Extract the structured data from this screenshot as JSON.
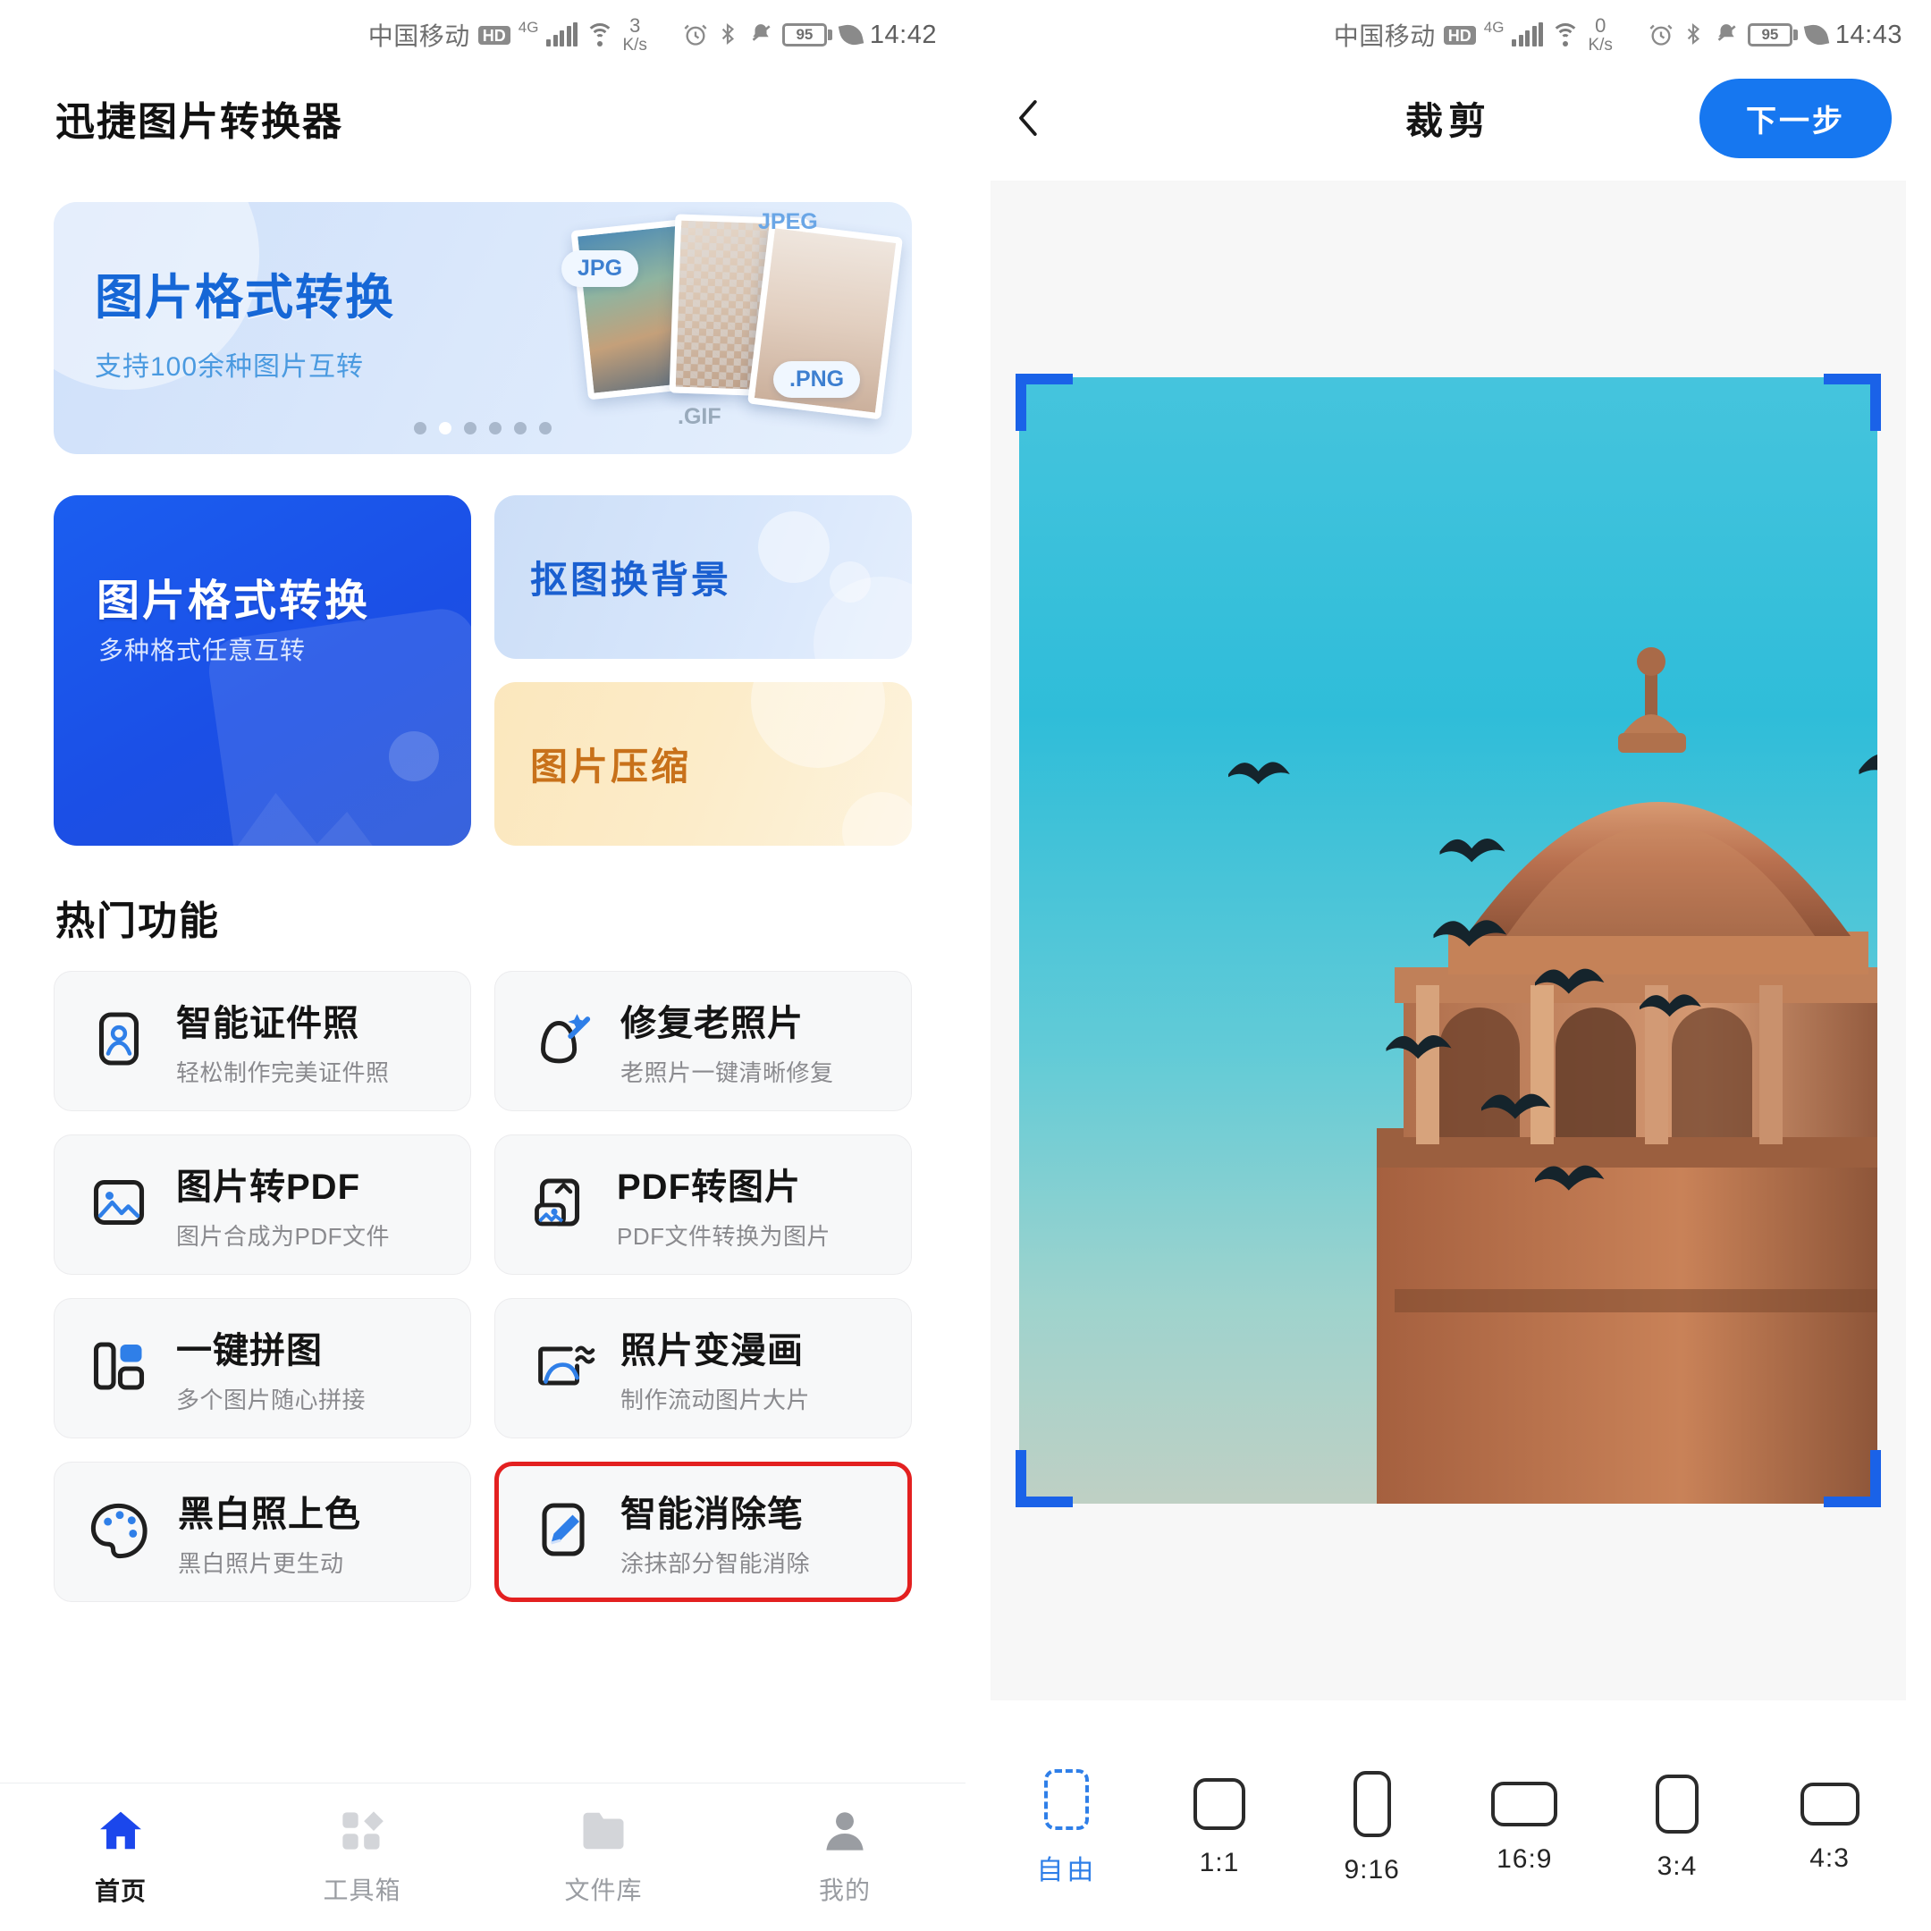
{
  "left": {
    "status": {
      "carrier": "中国移动",
      "hd": "HD",
      "net": "4G",
      "speed_value": "3",
      "speed_unit": "K/s",
      "battery": "95",
      "time": "14:42"
    },
    "app_title": "迅捷图片转换器",
    "banner": {
      "title": "图片格式转换",
      "subtitle": "支持100余种图片互转",
      "tags": {
        "jpg": "JPG",
        "jpeg": "JPEG",
        "png": ".PNG",
        "gif": ".GIF"
      },
      "dots_total": 6,
      "dots_active_index": 1
    },
    "quick_cards": [
      {
        "title": "图片格式转换",
        "subtitle": "多种格式任意互转"
      },
      {
        "title": "抠图换背景"
      },
      {
        "title": "图片压缩"
      }
    ],
    "section_title": "热门功能",
    "features": [
      {
        "title": "智能证件照",
        "subtitle": "轻松制作完美证件照",
        "icon": "id-photo-icon",
        "highlighted": false
      },
      {
        "title": "修复老照片",
        "subtitle": "老照片一键清晰修复",
        "icon": "magic-wand-icon",
        "highlighted": false
      },
      {
        "title": "图片转PDF",
        "subtitle": "图片合成为PDF文件",
        "icon": "image-to-pdf-icon",
        "highlighted": false
      },
      {
        "title": "PDF转图片",
        "subtitle": "PDF文件转换为图片",
        "icon": "pdf-to-image-icon",
        "highlighted": false
      },
      {
        "title": "一键拼图",
        "subtitle": "多个图片随心拼接",
        "icon": "collage-icon",
        "highlighted": false
      },
      {
        "title": "照片变漫画",
        "subtitle": "制作流动图片大片",
        "icon": "photo-to-comic-icon",
        "highlighted": false
      },
      {
        "title": "黑白照上色",
        "subtitle": "黑白照片更生动",
        "icon": "palette-icon",
        "highlighted": false
      },
      {
        "title": "智能消除笔",
        "subtitle": "涂抹部分智能消除",
        "icon": "eraser-pen-icon",
        "highlighted": true
      }
    ],
    "tabs": [
      {
        "label": "首页",
        "icon": "home-icon",
        "active": true
      },
      {
        "label": "工具箱",
        "icon": "toolbox-icon",
        "active": false
      },
      {
        "label": "文件库",
        "icon": "folder-icon",
        "active": false
      },
      {
        "label": "我的",
        "icon": "person-icon",
        "active": false
      }
    ]
  },
  "right": {
    "status": {
      "carrier": "中国移动",
      "hd": "HD",
      "net": "4G",
      "speed_value": "0",
      "speed_unit": "K/s",
      "battery": "95",
      "time": "14:43"
    },
    "header": {
      "back_icon": "chevron-left-icon",
      "title": "裁剪",
      "next_label": "下一步"
    },
    "ratios": [
      {
        "label": "自由",
        "selected": true,
        "w": 50,
        "h": 68
      },
      {
        "label": "1:1",
        "selected": false,
        "w": 58,
        "h": 58
      },
      {
        "label": "9:16",
        "selected": false,
        "w": 42,
        "h": 74
      },
      {
        "label": "16:9",
        "selected": false,
        "w": 74,
        "h": 50
      },
      {
        "label": "3:4",
        "selected": false,
        "w": 48,
        "h": 66
      },
      {
        "label": "4:3",
        "selected": false,
        "w": 66,
        "h": 48
      }
    ]
  },
  "colors": {
    "accent_blue": "#1677f0",
    "highlight_red": "#e32020",
    "card_bg": "#f7f8f9",
    "crop_handle": "#1a62e8"
  }
}
